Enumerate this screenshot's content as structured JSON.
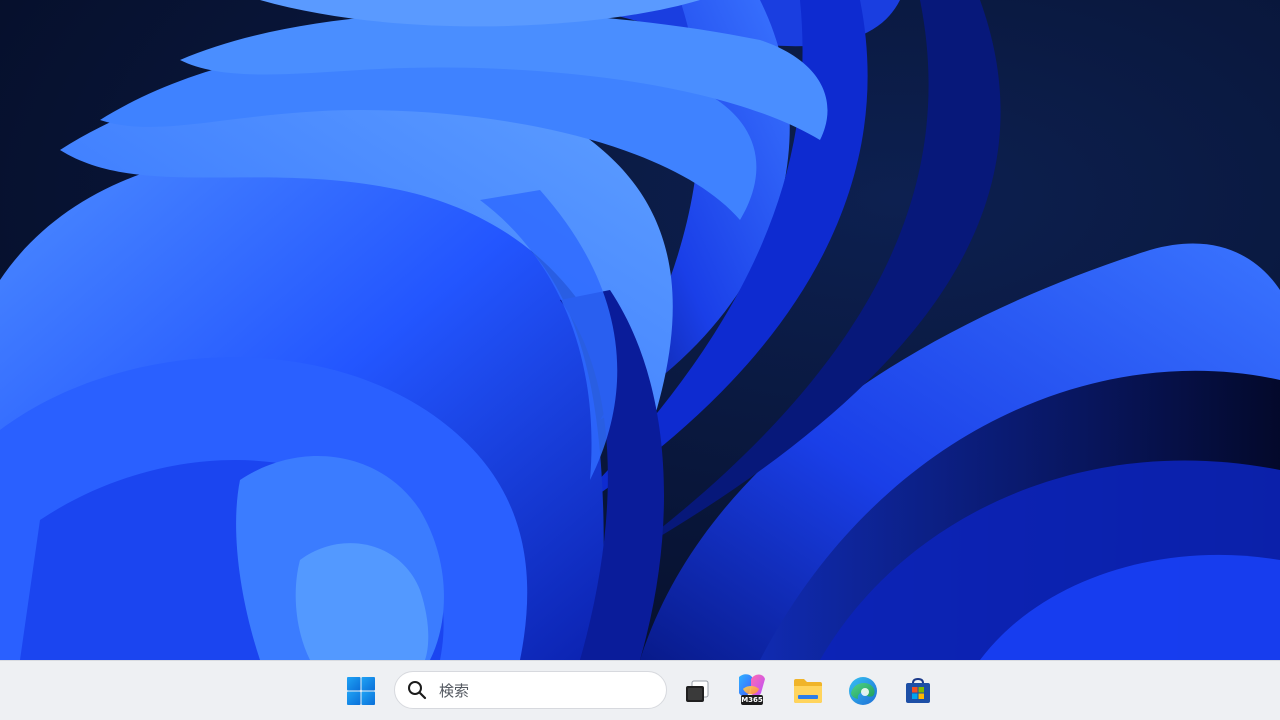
{
  "desktop": {
    "wallpaper": "windows-11-bloom-blue",
    "colors": {
      "background": "#061233",
      "bloom_light": "#3d7dff",
      "bloom_mid": "#1f4dff",
      "bloom_dark": "#0a1fa8"
    }
  },
  "taskbar": {
    "background": "#eef0f3",
    "start_icon": "windows-logo-icon",
    "search": {
      "icon": "search-icon",
      "placeholder": "検索"
    },
    "pinned_apps": [
      {
        "name": "task-view",
        "icon": "task-view-icon"
      },
      {
        "name": "microsoft-365-copilot",
        "icon": "m365-copilot-icon",
        "badge": "M365"
      },
      {
        "name": "file-explorer",
        "icon": "folder-icon"
      },
      {
        "name": "microsoft-edge",
        "icon": "edge-icon"
      },
      {
        "name": "microsoft-store",
        "icon": "store-icon"
      }
    ]
  }
}
